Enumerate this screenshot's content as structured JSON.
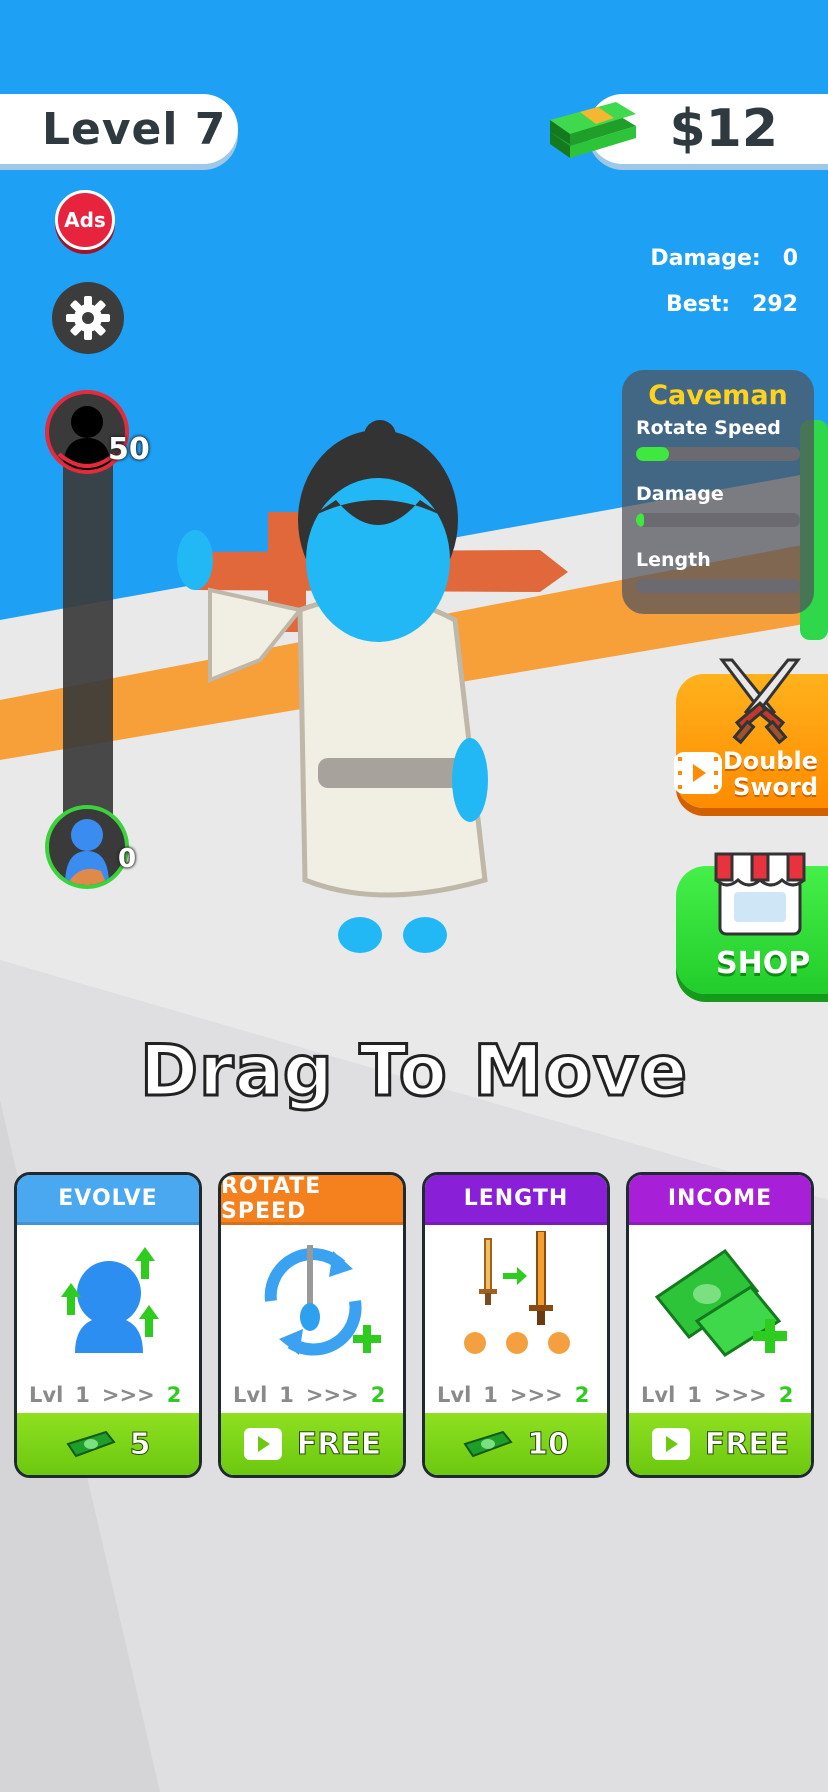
{
  "hud": {
    "level_label": "Level 7",
    "money": "$12",
    "ads_label": "Ads",
    "stats": {
      "damage_label": "Damage:",
      "damage_value": "0",
      "best_label": "Best:",
      "best_value": "292"
    }
  },
  "progress": {
    "boss_count": "50",
    "player_count": "0"
  },
  "weapon": {
    "name": "Caveman",
    "stats": [
      {
        "label": "Rotate Speed",
        "level": 0.2
      },
      {
        "label": "Damage",
        "level": 0.05
      },
      {
        "label": "Length",
        "level": 0.0
      }
    ]
  },
  "side_buttons": {
    "double_sword_line1": "Double",
    "double_sword_line2": "Sword",
    "shop_label": "SHOP"
  },
  "hint": "Drag To Move",
  "cards": [
    {
      "title": "EVOLVE",
      "lvl_label": "Lvl",
      "lvl_from": "1",
      "arrows": ">>>",
      "lvl_to": "2",
      "cost": "5",
      "cost_type": "cash",
      "color": "#4aa8f0"
    },
    {
      "title": "ROTATE SPEED",
      "lvl_label": "Lvl",
      "lvl_from": "1",
      "arrows": ">>>",
      "lvl_to": "2",
      "cost": "FREE",
      "cost_type": "video",
      "color": "#f5801e"
    },
    {
      "title": "LENGTH",
      "lvl_label": "Lvl",
      "lvl_from": "1",
      "arrows": ">>>",
      "lvl_to": "2",
      "cost": "10",
      "cost_type": "cash",
      "color": "#8a1fd8"
    },
    {
      "title": "INCOME",
      "lvl_label": "Lvl",
      "lvl_from": "1",
      "arrows": ">>>",
      "lvl_to": "2",
      "cost": "FREE",
      "cost_type": "video",
      "color": "#a81fd8"
    }
  ],
  "colors": {
    "sky": "#1ea0f5",
    "ground": "#e9e9ea",
    "orange_path": "#f7a03a",
    "accent_green": "#3ee83e"
  }
}
